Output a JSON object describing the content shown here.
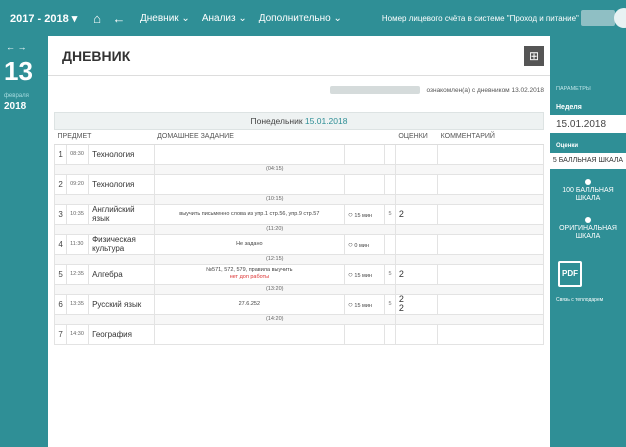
{
  "topbar": {
    "year": "2017 - 2018 ▾",
    "home_icon": "home-icon",
    "back_icon": "back-arrow-icon",
    "nav": [
      "Дневник ⌄",
      "Анализ ⌄",
      "Дополнительно ⌄"
    ],
    "account_label": "Номер лицевого счёта в системе \"Проход и питание\""
  },
  "leftrail": {
    "arrows": "← →",
    "day": "13",
    "month": "февраля",
    "year": "2018"
  },
  "main": {
    "title": "ДНЕВНИК",
    "grid_icon": "grid-icon",
    "ack_text": "ознакомлен(а) с дневником 13.02.2018",
    "day_label": "Понедельник",
    "day_date": "15.01.2018",
    "columns": [
      "ПРЕДМЕТ",
      "ДОМАШНЕЕ ЗАДАНИЕ",
      "",
      "ОЦЕНКИ",
      "КОММЕНТАРИЙ"
    ],
    "lessons": [
      {
        "num": "1",
        "time": "08:30",
        "subject": "Технология",
        "hw": "",
        "hw_red": "",
        "dur": "",
        "mark_type": "",
        "mark": "",
        "topic": "(04:15)"
      },
      {
        "num": "2",
        "time": "09:20",
        "subject": "Технология",
        "hw": "",
        "hw_red": "",
        "dur": "",
        "mark_type": "",
        "mark": "",
        "topic": "(10:15)"
      },
      {
        "num": "3",
        "time": "10:35",
        "subject": "Английский язык",
        "hw": "выучить письменно слова из упр.1 стр.56, упр.9 стр.57",
        "hw_red": "",
        "dur": "15 мин",
        "mark_type": "5",
        "mark": "2",
        "topic": "(11:20)"
      },
      {
        "num": "4",
        "time": "11:30",
        "subject": "Физическая культура",
        "hw": "Не задано",
        "hw_red": "",
        "dur": "0 мин",
        "mark_type": "",
        "mark": "",
        "topic": "(12:15)"
      },
      {
        "num": "5",
        "time": "12:35",
        "subject": "Алгебра",
        "hw": "№571, 572, 579, правила выучить",
        "hw_red": "нет доп работы",
        "dur": "15 мин",
        "mark_type": "5",
        "mark": "2",
        "topic": "(13:20)"
      },
      {
        "num": "6",
        "time": "13:35",
        "subject": "Русский язык",
        "hw": "27.6.252",
        "hw_red": "",
        "dur": "15 мин",
        "mark_type": "5",
        "mark": "2\n2",
        "topic": "(14:20)"
      },
      {
        "num": "7",
        "time": "14:30",
        "subject": "География",
        "hw": "",
        "hw_red": "",
        "dur": "",
        "mark_type": "",
        "mark": "",
        "topic": ""
      }
    ]
  },
  "rightpanel": {
    "params_label": "ПАРАМЕТРЫ",
    "week_label": "Неделя",
    "week_date": "15.01.2018",
    "grades_label": "Оценки",
    "scales": [
      "5 БАЛЛЬНАЯ ШКАЛА",
      "100 БАЛЛЬНАЯ ШКАЛА",
      "ОРИГИНАЛЬНАЯ ШКАЛА"
    ],
    "pdf_label": "PDF",
    "contact": "Связь с теплодарем"
  },
  "colors": {
    "accent": "#2f8f96",
    "red": "#d33333"
  }
}
